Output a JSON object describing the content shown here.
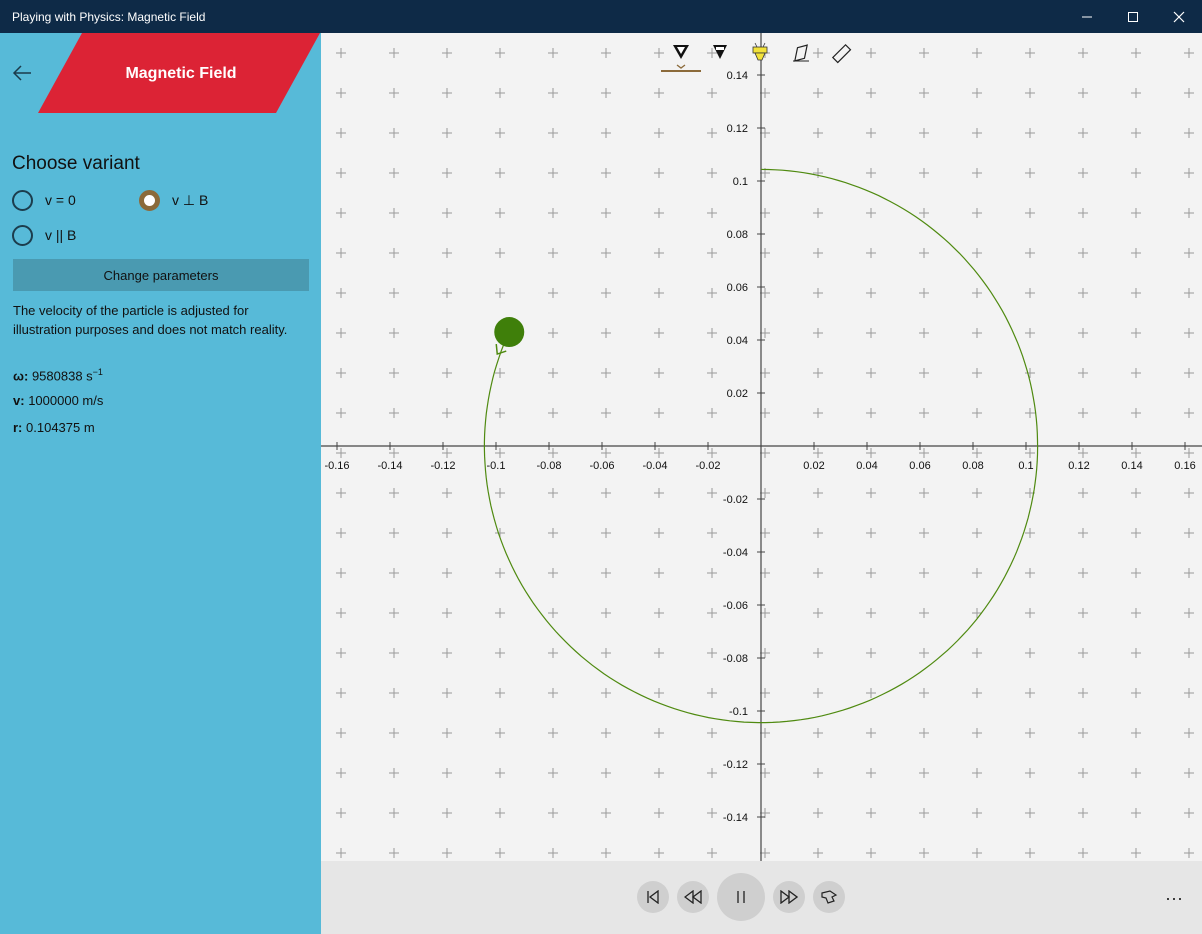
{
  "window": {
    "title": "Playing with Physics: Magnetic Field"
  },
  "header": {
    "title": "Magnetic Field"
  },
  "sidebar": {
    "heading": "Choose variant",
    "variants": [
      {
        "label": "v = 0",
        "checked": false
      },
      {
        "label": "v ⊥ B",
        "checked": true
      },
      {
        "label": "v || B",
        "checked": false
      }
    ],
    "change_button": "Change parameters",
    "note": "The velocity of the particle is adjusted for illustration purposes and does not match reality.",
    "stats": {
      "omega_label": "ω:",
      "omega_value": "9580838 s",
      "omega_exp": "−1",
      "v_label": "v:",
      "v_value": "1000000 m/s",
      "r_label": "r:",
      "r_value": "0.104375 m"
    }
  },
  "toolbar": {
    "tools": [
      "pen-tool-icon",
      "pen-dark-tool-icon",
      "highlighter-tool-icon",
      "eraser-tool-icon",
      "ruler-tool-icon"
    ]
  },
  "player": {
    "more_label": "···"
  },
  "colors": {
    "accent": "#dc2335",
    "sidebar": "#57bad8",
    "trajectory": "#4f8a10",
    "particle": "#3f7f0a"
  },
  "chart_data": {
    "type": "scatter",
    "title": "",
    "xlim": [
      -0.16,
      0.16
    ],
    "ylim": [
      -0.14,
      0.14
    ],
    "x_ticks": [
      -0.16,
      -0.14,
      -0.12,
      -0.1,
      -0.08,
      -0.06,
      -0.04,
      -0.02,
      0.02,
      0.04,
      0.06,
      0.08,
      0.1,
      0.12,
      0.14,
      0.16
    ],
    "y_ticks": [
      -0.14,
      -0.12,
      -0.1,
      -0.08,
      -0.06,
      -0.04,
      -0.02,
      0.02,
      0.04,
      0.06,
      0.08,
      0.1,
      0.12,
      0.14
    ],
    "x_tick_labels": [
      "-0.16",
      "-0.14",
      "-0.12",
      "-0.1",
      "-0.08",
      "-0.06",
      "-0.04",
      "-0.02",
      "0.02",
      "0.04",
      "0.06",
      "0.08",
      "0.1",
      "0.12",
      "0.14",
      "0.16"
    ],
    "y_tick_labels": [
      "-0.14",
      "-0.12",
      "-0.1",
      "-0.08",
      "-0.06",
      "-0.04",
      "-0.02",
      "0.02",
      "0.04",
      "0.06",
      "0.08",
      "0.1",
      "0.12",
      "0.14"
    ],
    "trajectory": {
      "center": [
        0,
        0
      ],
      "radius": 0.104375,
      "start_angle_deg": 90,
      "end_angle_deg": 154,
      "direction": "clockwise"
    },
    "particle": {
      "x": -0.095,
      "y": 0.043
    },
    "field_marker": "+"
  }
}
